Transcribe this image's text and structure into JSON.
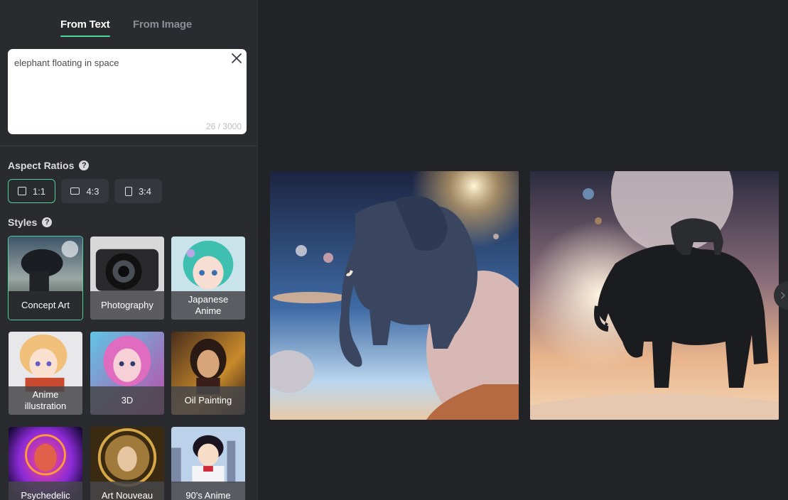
{
  "tabs": {
    "from_text": "From Text",
    "from_image": "From Image"
  },
  "prompt": {
    "value": "elephant floating in space",
    "count": "26 / 3000"
  },
  "aspect_ratios": {
    "title": "Aspect Ratios",
    "options": [
      "1:1",
      "4:3",
      "3:4"
    ],
    "selected": "1:1"
  },
  "styles": {
    "title": "Styles",
    "items": [
      "Concept Art",
      "Photography",
      "Japanese Anime",
      "Anime illustration",
      "3D",
      "Oil Painting",
      "Psychedelic",
      "Art Nouveau",
      "90's Anime"
    ],
    "selected": "Concept Art"
  },
  "colors": {
    "accent": "#4bd39a",
    "sidebar": "#2a2b2f",
    "background": "#222326"
  },
  "icons": {
    "clear": "close-icon",
    "help": "question-circle-icon",
    "next": "chevron-right-icon"
  }
}
